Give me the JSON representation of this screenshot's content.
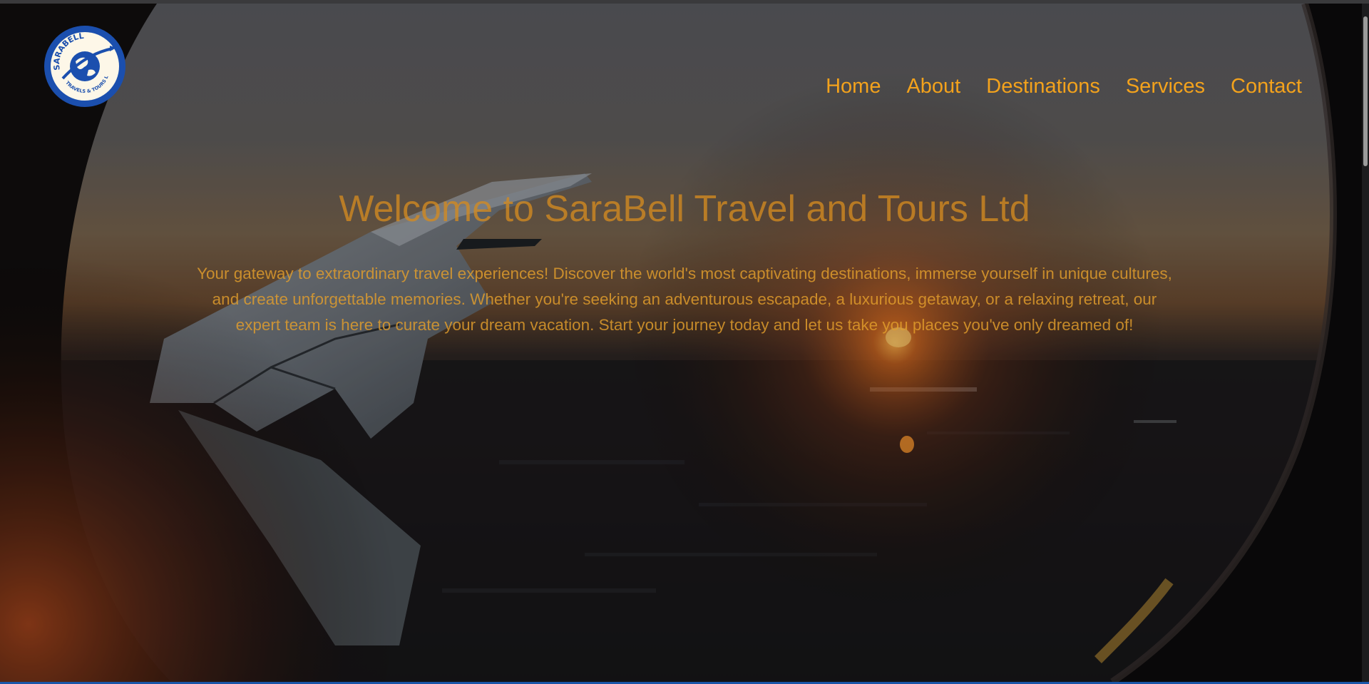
{
  "brand": {
    "logo_text_top": "SARABELL",
    "logo_text_bottom": "TRAVELS & TOURS LTD"
  },
  "nav": {
    "items": [
      {
        "label": "Home"
      },
      {
        "label": "About"
      },
      {
        "label": "Destinations"
      },
      {
        "label": "Services"
      },
      {
        "label": "Contact"
      }
    ]
  },
  "hero": {
    "title": "Welcome to SaraBell Travel and Tours Ltd",
    "description": "Your gateway to extraordinary travel experiences! Discover the world's most captivating destinations, immerse yourself in unique cultures, and create unforgettable memories. Whether you're seeking an adventurous escapade, a luxurious getaway, or a relaxing retreat, our expert team is here to curate your dream vacation. Start your journey today and let us take you places you've only dreamed of!",
    "background_image": "airplane-window-sunset"
  },
  "colors": {
    "accent": "#f3a21c",
    "logo_blue": "#1b4fae",
    "page_bg": "#0b0a0b"
  }
}
